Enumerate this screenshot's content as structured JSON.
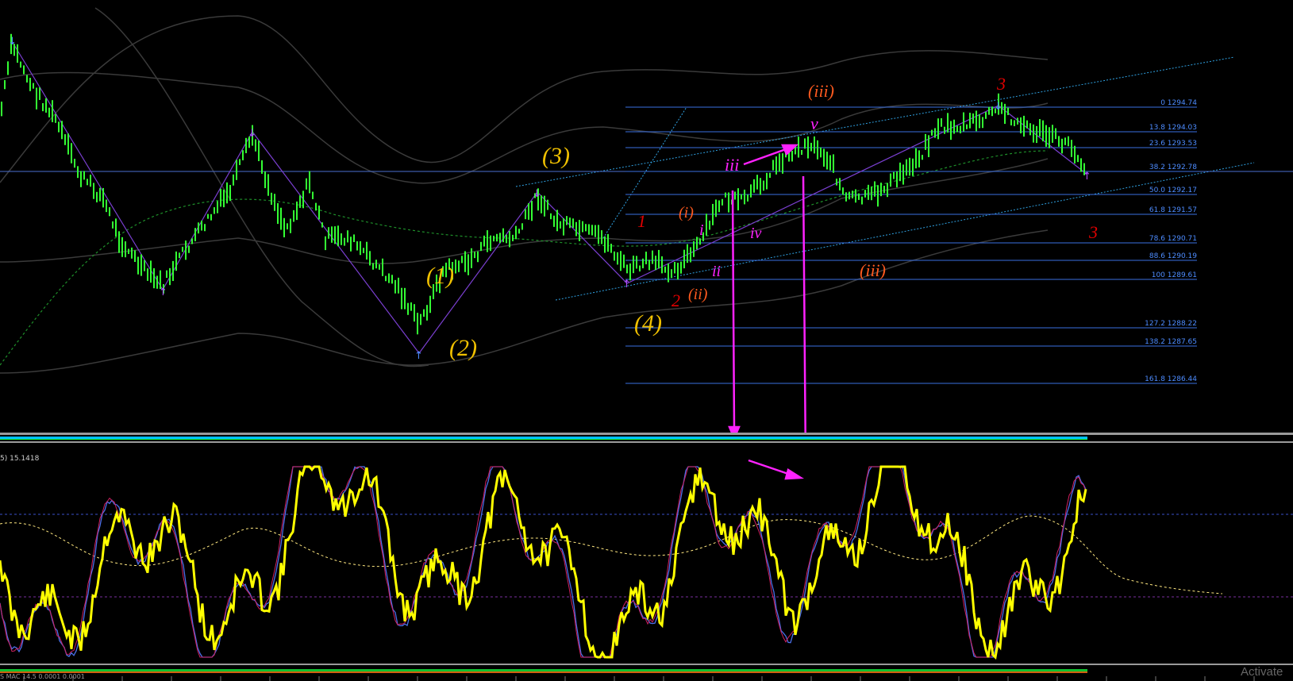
{
  "price_panel": {
    "fib_levels": [
      {
        "label": "0 1294.74"
      },
      {
        "label": "13.8 1294.03"
      },
      {
        "label": "23.6 1293.53"
      },
      {
        "label": "38.2 1292.78"
      },
      {
        "label": "50.0 1292.17"
      },
      {
        "label": "61.8 1291.57"
      },
      {
        "label": "78.6 1290.71"
      },
      {
        "label": "88.6 1290.19"
      },
      {
        "label": "100 1289.61"
      },
      {
        "label": "127.2 1288.22"
      },
      {
        "label": "138.2 1287.65"
      },
      {
        "label": "161.8 1286.44"
      }
    ],
    "wave_labels": [
      {
        "text": "(1)",
        "color": "#f0c000"
      },
      {
        "text": "(2)",
        "color": "#f0c000"
      },
      {
        "text": "(3)",
        "color": "#f0c000"
      },
      {
        "text": "(4)",
        "color": "#f0c000"
      },
      {
        "text": "1",
        "color": "#e00000"
      },
      {
        "text": "2",
        "color": "#e00000"
      },
      {
        "text": "3",
        "color": "#e00000"
      },
      {
        "text": "3",
        "color": "#e00000"
      },
      {
        "text": "(i)",
        "color": "#ff5a1f"
      },
      {
        "text": "(ii)",
        "color": "#ff5a1f"
      },
      {
        "text": "(iii)",
        "color": "#ff5a1f"
      },
      {
        "text": "(iii)",
        "color": "#ff5a1f"
      },
      {
        "text": "i",
        "color": "#ff22ff"
      },
      {
        "text": "ii",
        "color": "#ff22ff"
      },
      {
        "text": "iii",
        "color": "#ff22ff"
      },
      {
        "text": "iv",
        "color": "#ff22ff"
      },
      {
        "text": "v",
        "color": "#ff22ff"
      }
    ]
  },
  "oscillator_panel": {
    "label": "5) 15.1418"
  },
  "bottom_panel": {
    "label": "S MAC 14.5 0.0001 0.0001"
  },
  "watermark": {
    "text": "Activate"
  },
  "colors": {
    "background": "#000000",
    "candles": "#33ff33",
    "fib_line": "#3a6fe0",
    "oscillator_main": "#ffff00",
    "divergence_arrow": "#ff22ff"
  }
}
